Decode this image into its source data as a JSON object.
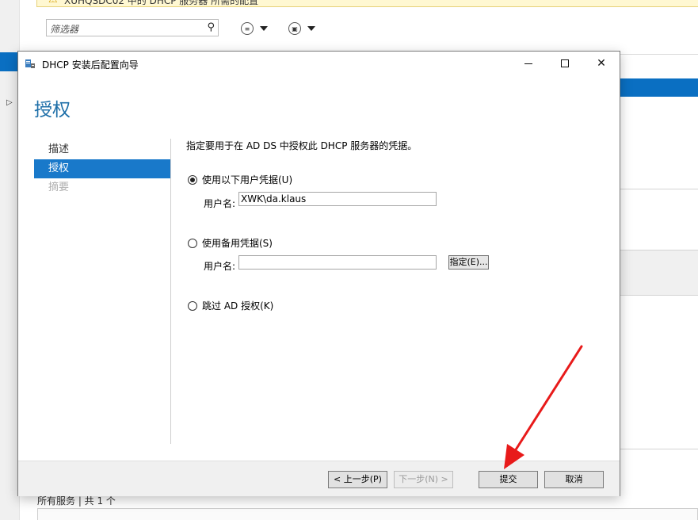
{
  "background": {
    "banner_text": "XUHQSDC02 中的 DHCP 服务器 所需的配置",
    "filter_placeholder": "筛选器",
    "footer_text": "所有服务 | 共 1 个"
  },
  "dialog": {
    "title": "DHCP 安装后配置向导",
    "page_title": "授权",
    "nav": {
      "items": [
        {
          "label": "描述"
        },
        {
          "label": "授权"
        },
        {
          "label": "摘要"
        }
      ]
    },
    "instruction": "指定要用于在 AD DS 中授权此 DHCP 服务器的凭据。",
    "option_current": {
      "label": "使用以下用户凭据(U)",
      "checked": true,
      "username_label": "用户名:",
      "username_value": "XWK\\da.klaus"
    },
    "option_alternate": {
      "label": "使用备用凭据(S)",
      "checked": false,
      "username_label": "用户名:",
      "username_value": "",
      "assign_label": "指定(E)..."
    },
    "option_skip": {
      "label": "跳过 AD 授权(K)",
      "checked": false
    },
    "footer": {
      "prev_label": "< 上一步(P)",
      "next_label": "下一步(N) >",
      "submit_label": "提交",
      "cancel_label": "取消"
    }
  },
  "colors": {
    "accent": "#1979ca",
    "title": "#1e6fa8",
    "annotation_arrow": "#e81a1a"
  }
}
